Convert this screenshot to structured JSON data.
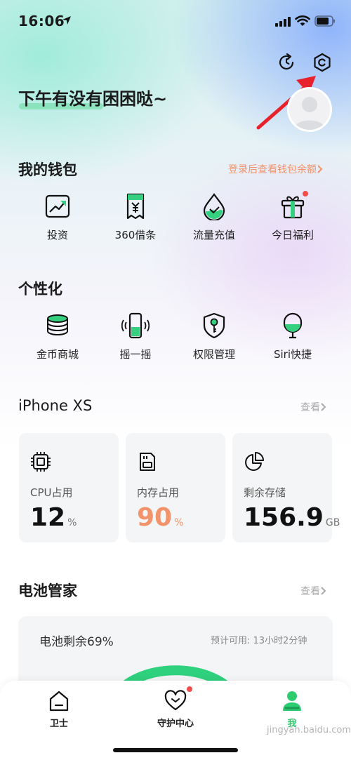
{
  "status": {
    "time": "16:06"
  },
  "greeting": "下午有没有困困哒~",
  "wallet": {
    "title": "我的钱包",
    "link": "登录后查看钱包余额",
    "items": [
      {
        "label": "投资",
        "icon": "chart-trend-icon"
      },
      {
        "label": "360借条",
        "icon": "yuan-receipt-icon"
      },
      {
        "label": "流量充值",
        "icon": "water-drop-icon"
      },
      {
        "label": "今日福利",
        "icon": "gift-icon",
        "badge": true
      }
    ]
  },
  "personal": {
    "title": "个性化",
    "items": [
      {
        "label": "金币商城",
        "icon": "coin-stack-icon"
      },
      {
        "label": "摇一摇",
        "icon": "phone-shake-icon"
      },
      {
        "label": "权限管理",
        "icon": "shield-key-icon"
      },
      {
        "label": "Siri快捷",
        "icon": "microphone-icon"
      }
    ]
  },
  "device": {
    "title": "iPhone XS",
    "link": "查看",
    "cards": [
      {
        "label": "CPU占用",
        "value": "12",
        "unit": "%",
        "icon": "cpu-icon"
      },
      {
        "label": "内存占用",
        "value": "90",
        "unit": "%",
        "icon": "memory-icon"
      },
      {
        "label": "剩余存储",
        "value": "156.9",
        "unit": "GB",
        "icon": "pie-chart-icon"
      }
    ]
  },
  "battery": {
    "title": "电池管家",
    "link": "查看",
    "remaining": "电池剩余69%",
    "estimate": "预计可用: 13小时2分钟",
    "level": 0.69
  },
  "tabs": [
    {
      "label": "卫士",
      "icon": "home-icon"
    },
    {
      "label": "守护中心",
      "icon": "heart-icon",
      "badge": true
    },
    {
      "label": "我",
      "icon": "person-icon",
      "active": true
    }
  ],
  "watermark": "jingyan.baidu.com",
  "colors": {
    "accent": "#2ecc71",
    "orange": "#f2936b",
    "badge": "#f44b4b"
  }
}
